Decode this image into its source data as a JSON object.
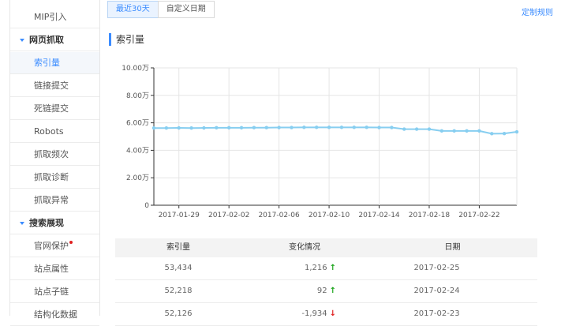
{
  "sidebar": {
    "items": [
      {
        "label": "MIP引入",
        "type": "item"
      },
      {
        "label": "网页抓取",
        "type": "group"
      },
      {
        "label": "索引量",
        "type": "item",
        "active": true
      },
      {
        "label": "链接提交",
        "type": "item"
      },
      {
        "label": "死链提交",
        "type": "item"
      },
      {
        "label": "Robots",
        "type": "item"
      },
      {
        "label": "抓取频次",
        "type": "item"
      },
      {
        "label": "抓取诊断",
        "type": "item"
      },
      {
        "label": "抓取异常",
        "type": "item"
      },
      {
        "label": "搜索展现",
        "type": "group"
      },
      {
        "label": "官网保护",
        "type": "item",
        "badge": true
      },
      {
        "label": "站点属性",
        "type": "item"
      },
      {
        "label": "站点子链",
        "type": "item"
      },
      {
        "label": "结构化数据",
        "type": "item"
      }
    ]
  },
  "toolbar": {
    "tabs": [
      "最近30天",
      "自定义日期"
    ],
    "custom_rule_link": "定制规则"
  },
  "section": {
    "title": "索引量"
  },
  "chart_data": {
    "type": "line",
    "series": [
      {
        "values": [
          56200,
          56200,
          56300,
          56200,
          56300,
          56400,
          56400,
          56400,
          56500,
          56500,
          56600,
          56600,
          56700,
          56700,
          56700,
          56700,
          56700,
          56700,
          56600,
          56600,
          55400,
          55400,
          55400,
          54100,
          54100,
          54100,
          54100,
          52100,
          52200,
          53434
        ]
      }
    ],
    "x_tick_labels": [
      "2017-01-29",
      "2017-02-02",
      "2017-02-06",
      "2017-02-10",
      "2017-02-14",
      "2017-02-18",
      "2017-02-22"
    ],
    "x_start": "2017-01-27",
    "x_end": "2017-02-25",
    "y_tick_labels": [
      "0",
      "2.00万",
      "4.00万",
      "6.00万",
      "8.00万",
      "10.00万"
    ],
    "ylim": [
      0,
      100000
    ],
    "grid": true,
    "color": "#87cef0"
  },
  "table": {
    "headers": [
      "索引量",
      "变化情况",
      "日期"
    ],
    "rows": [
      {
        "count": "53,434",
        "change": "1,216",
        "dir": "up",
        "date": "2017-02-25"
      },
      {
        "count": "52,218",
        "change": "92",
        "dir": "up",
        "date": "2017-02-24"
      },
      {
        "count": "52,126",
        "change": "-1,934",
        "dir": "down",
        "date": "2017-02-23"
      }
    ]
  }
}
